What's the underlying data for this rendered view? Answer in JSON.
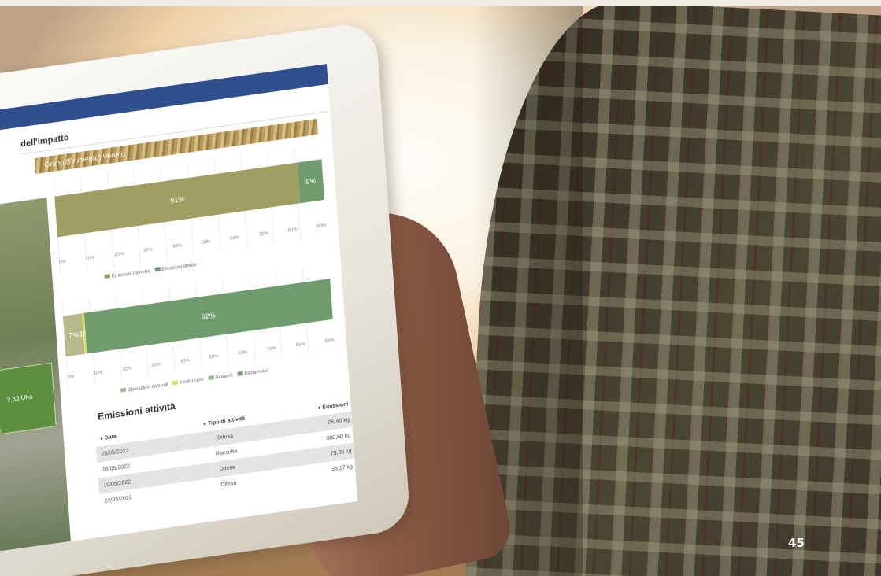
{
  "screen": {
    "section_title": "dell'impatto",
    "crop_banner": "Grano (Frumento) Veneto",
    "field_label": "3,83 Uha",
    "chart1": {
      "segments": [
        {
          "label": "91%",
          "value": 91,
          "color": "#a19e63"
        },
        {
          "label": "9%",
          "value": 9,
          "color": "#6f9b6f"
        }
      ],
      "ticks": [
        "0%",
        "10%",
        "20%",
        "30%",
        "40%",
        "50%",
        "60%",
        "70%",
        "80%",
        "90%"
      ],
      "legend": [
        {
          "label": "Emissioni indirette",
          "color": "#a19e63"
        },
        {
          "label": "Emissioni dirette",
          "color": "#6f9b6f"
        }
      ]
    },
    "chart2": {
      "segments": [
        {
          "label": "7%",
          "value": 7,
          "color": "#b8b98a"
        },
        {
          "label": "1%",
          "value": 1,
          "color": "#d9dc6b"
        },
        {
          "label": "92%",
          "value": 92,
          "color": "#6f9b6f"
        }
      ],
      "ticks": [
        "0%",
        "10%",
        "20%",
        "30%",
        "40%",
        "50%",
        "60%",
        "70%",
        "80%",
        "90%"
      ],
      "legend": [
        {
          "label": "Operazioni colturali",
          "color": "#b8b98a"
        },
        {
          "label": "Fertilizzanti",
          "color": "#d9dc6b"
        },
        {
          "label": "Sementi",
          "color": "#8fbf8f"
        },
        {
          "label": "Fitofarmaci",
          "color": "#6f9b6f"
        }
      ]
    },
    "emissions": {
      "title": "Emissioni attività",
      "headers": [
        "♦ Data",
        "♦ Tipo di attività",
        "♦ Emissioni"
      ],
      "rows": [
        [
          "25/05/2022",
          "Difesa",
          "06,40 kg"
        ],
        [
          "18/05/2022",
          "Raccolta",
          "380,60 kg"
        ],
        [
          "19/05/2022",
          "Difesa",
          "75,85 kg"
        ],
        [
          "22/05/2022",
          "Difesa",
          "35,17 kg"
        ]
      ]
    }
  },
  "page_number": "45"
}
